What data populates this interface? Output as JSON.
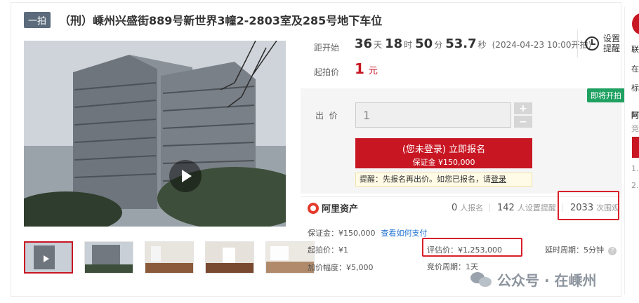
{
  "header": {
    "badge": "一拍",
    "title": "（刑）嵊州兴盛街889号新世界3幢2-2803室及285号地下车位"
  },
  "auction": {
    "countdown_label": "距开始",
    "days": "36",
    "days_unit": "天",
    "hours": "18",
    "hours_unit": "时",
    "minutes": "50",
    "minutes_unit": "分",
    "seconds": "53.7",
    "seconds_unit": "秒",
    "start_date": "(2024-04-23 10:00开拍)",
    "start_price_label": "起拍价",
    "start_price": "1",
    "start_price_unit": "元",
    "remind_label_line1": "设置",
    "remind_label_line2": "提醒",
    "soon_tag": "即将开拍"
  },
  "bid": {
    "label": "出  价",
    "value": "1",
    "plus": "+",
    "minus": "−",
    "signup_main": "(您未登录) 立即报名",
    "signup_deposit": "保证金 ¥150,000",
    "tip_text": "提醒：先报名再出价。如您已报名，请",
    "tip_login": "登录"
  },
  "stats": {
    "brand": "阿里资产",
    "signup_count": "0",
    "signup_label": "人报名",
    "remind_count": "142",
    "remind_label": "人设置提醒",
    "view_count": "2033",
    "view_label": "次围观"
  },
  "details": {
    "deposit": "保证金：¥150,000",
    "deposit_link": "查看如何支付",
    "start_price": "起拍价：¥1",
    "appraisal": "评估价：¥1,253,000",
    "delay": "延时周期：5分钟",
    "increment": "加价幅度：¥5,000",
    "cycle": "竞价周期：1天"
  },
  "sidebar": {
    "t1": "联",
    "t2": "在",
    "t3": "标",
    "t4": "阿",
    "t5": "竞",
    "t6": "1.",
    "t7": "2."
  },
  "watermark": {
    "text": "公众号 · 在嵊州"
  },
  "colors": {
    "accent_red": "#c81623",
    "green_tag": "#20a162",
    "link_blue": "#1a6fd1"
  }
}
